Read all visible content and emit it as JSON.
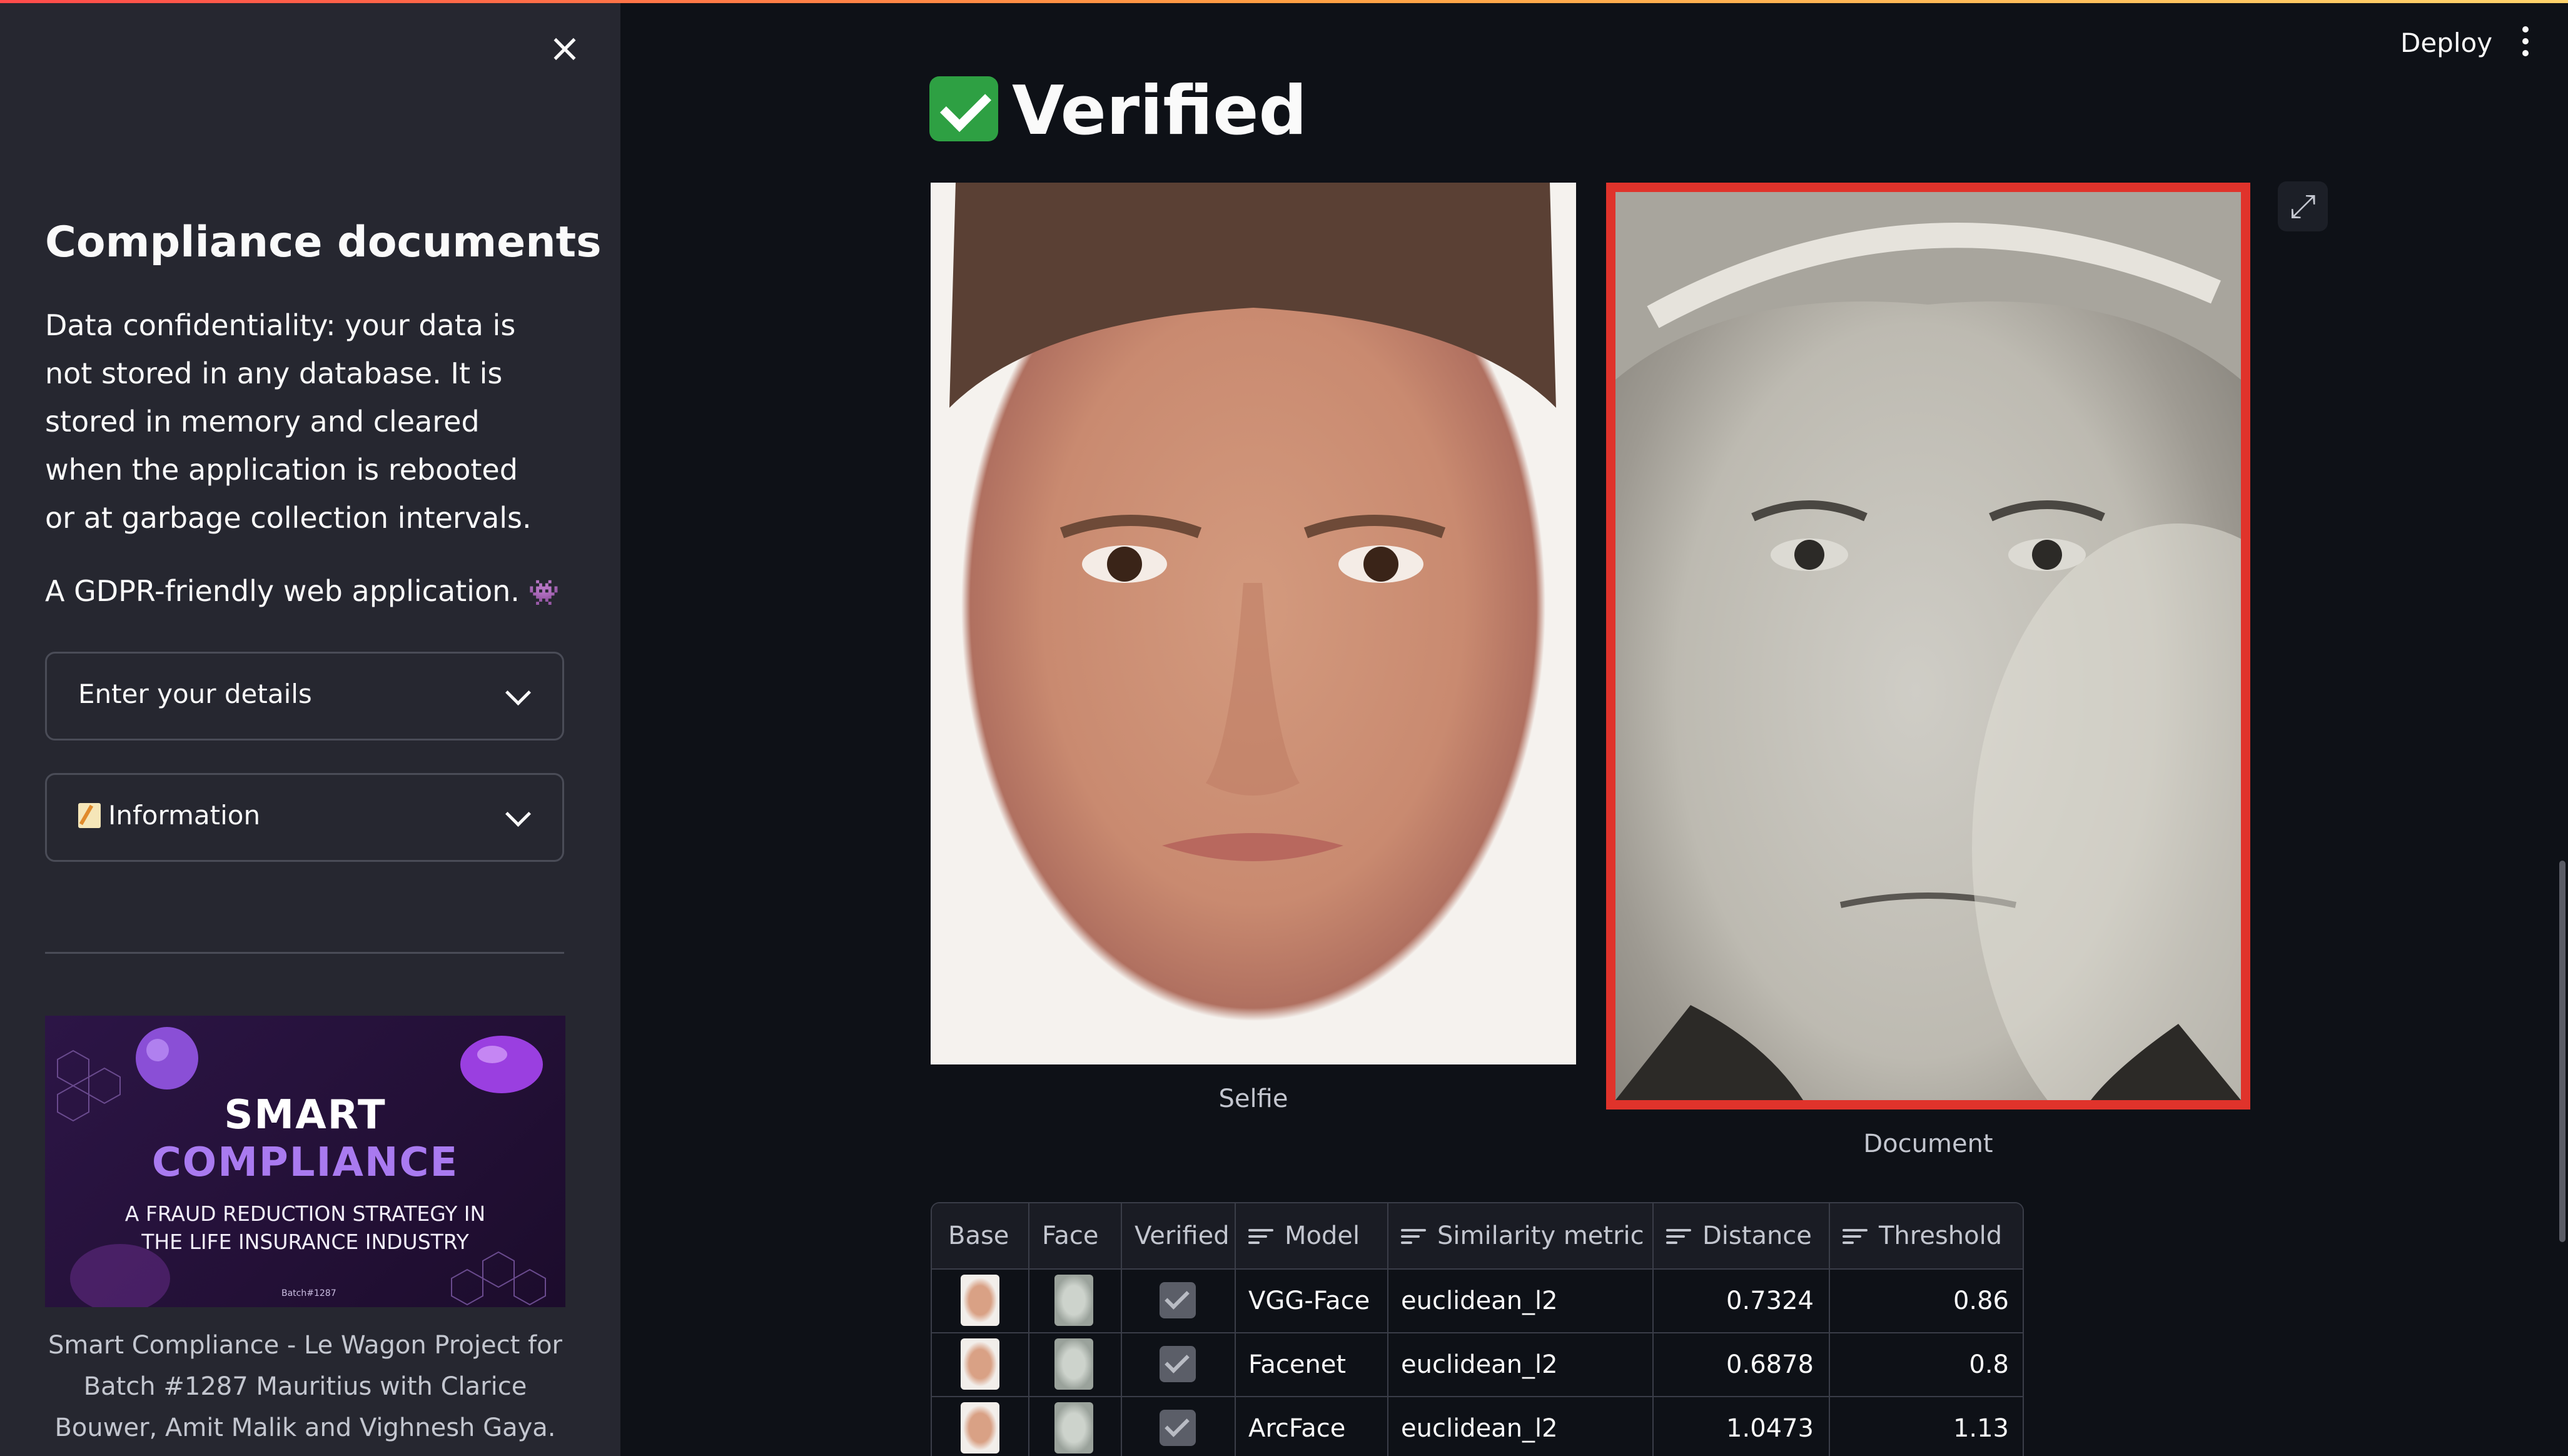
{
  "sidebar": {
    "close_label": "×",
    "title": "Compliance documents",
    "paragraph": "Data confidentiality: your data is not stored in any database. It is stored in memory and cleared when the application is rebooted or at garbage collection intervals.",
    "gdpr": "A GDPR-friendly web application.",
    "gdpr_icon": "alien-monster-icon",
    "expanders": [
      {
        "label": "Enter your details",
        "icon": null
      },
      {
        "label": "Information",
        "icon": "memo-icon"
      }
    ],
    "banner": {
      "line1": "SMART",
      "line2": "COMPLIANCE",
      "line3": "A FRAUD REDUCTION STRATEGY IN THE LIFE INSURANCE INDUSTRY",
      "line4": "Batch#1287"
    },
    "caption": "Smart Compliance - Le Wagon Project for Batch #1287 Mauritius with Clarice Bouwer, Amit Malik and Vighnesh Gaya."
  },
  "header": {
    "deploy_label": "Deploy",
    "menu_icon": "vertical-dots-icon"
  },
  "main": {
    "status_title": "Verified",
    "status_icon": "green-check-icon",
    "images": [
      {
        "caption": "Selfie"
      },
      {
        "caption": "Document"
      }
    ],
    "expand_icon": "fullscreen-icon",
    "table": {
      "columns": [
        "Base",
        "Face",
        "Verified",
        "Model",
        "Similarity metric",
        "Distance",
        "Threshold"
      ],
      "rows": [
        {
          "model": "VGG-Face",
          "metric": "euclidean_l2",
          "distance": "0.7324",
          "threshold": "0.86",
          "verified": true
        },
        {
          "model": "Facenet",
          "metric": "euclidean_l2",
          "distance": "0.6878",
          "threshold": "0.8",
          "verified": true
        },
        {
          "model": "ArcFace",
          "metric": "euclidean_l2",
          "distance": "1.0473",
          "threshold": "1.13",
          "verified": true
        }
      ]
    }
  },
  "colors": {
    "background": "#0e1117",
    "sidebar": "#262730",
    "document_border": "#e0332b",
    "banner_accent": "#a97af0",
    "check_green": "#2ea043"
  }
}
